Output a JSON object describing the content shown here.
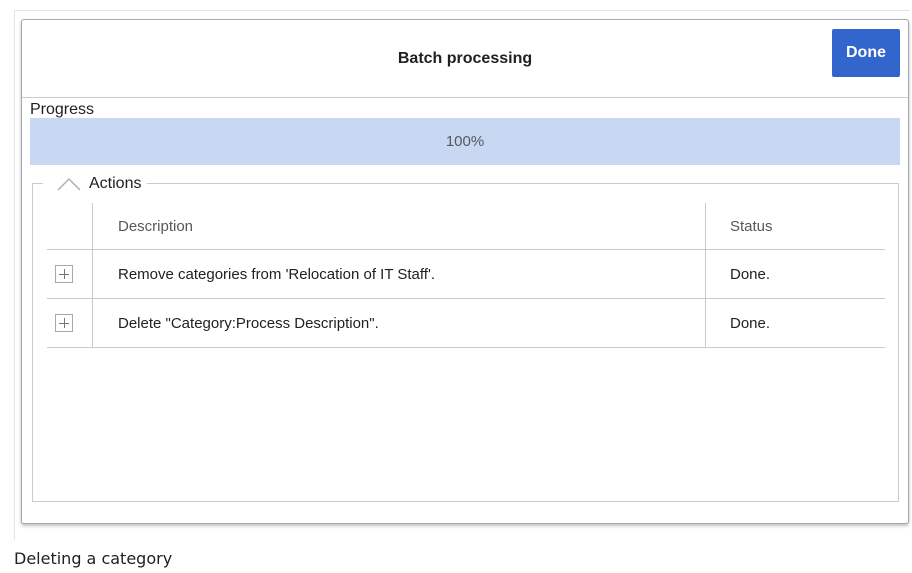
{
  "dialog": {
    "title": "Batch processing",
    "done_label": "Done"
  },
  "progress": {
    "label": "Progress",
    "value_text": "100%",
    "fraction": 1.0
  },
  "actions": {
    "legend": "Actions",
    "columns": {
      "description": "Description",
      "status": "Status"
    },
    "rows": [
      {
        "description": "Remove categories from 'Relocation of IT Staff'.",
        "status": "Done."
      },
      {
        "description": "Delete \"Category:Process Description\".",
        "status": "Done."
      }
    ]
  },
  "caption": "Deleting a category",
  "colors": {
    "accent": "#3366cc",
    "progress_fill": "#c8d7f2"
  },
  "icons": {
    "legend": "chevron-up-icon",
    "row_expand": "plus-icon"
  }
}
